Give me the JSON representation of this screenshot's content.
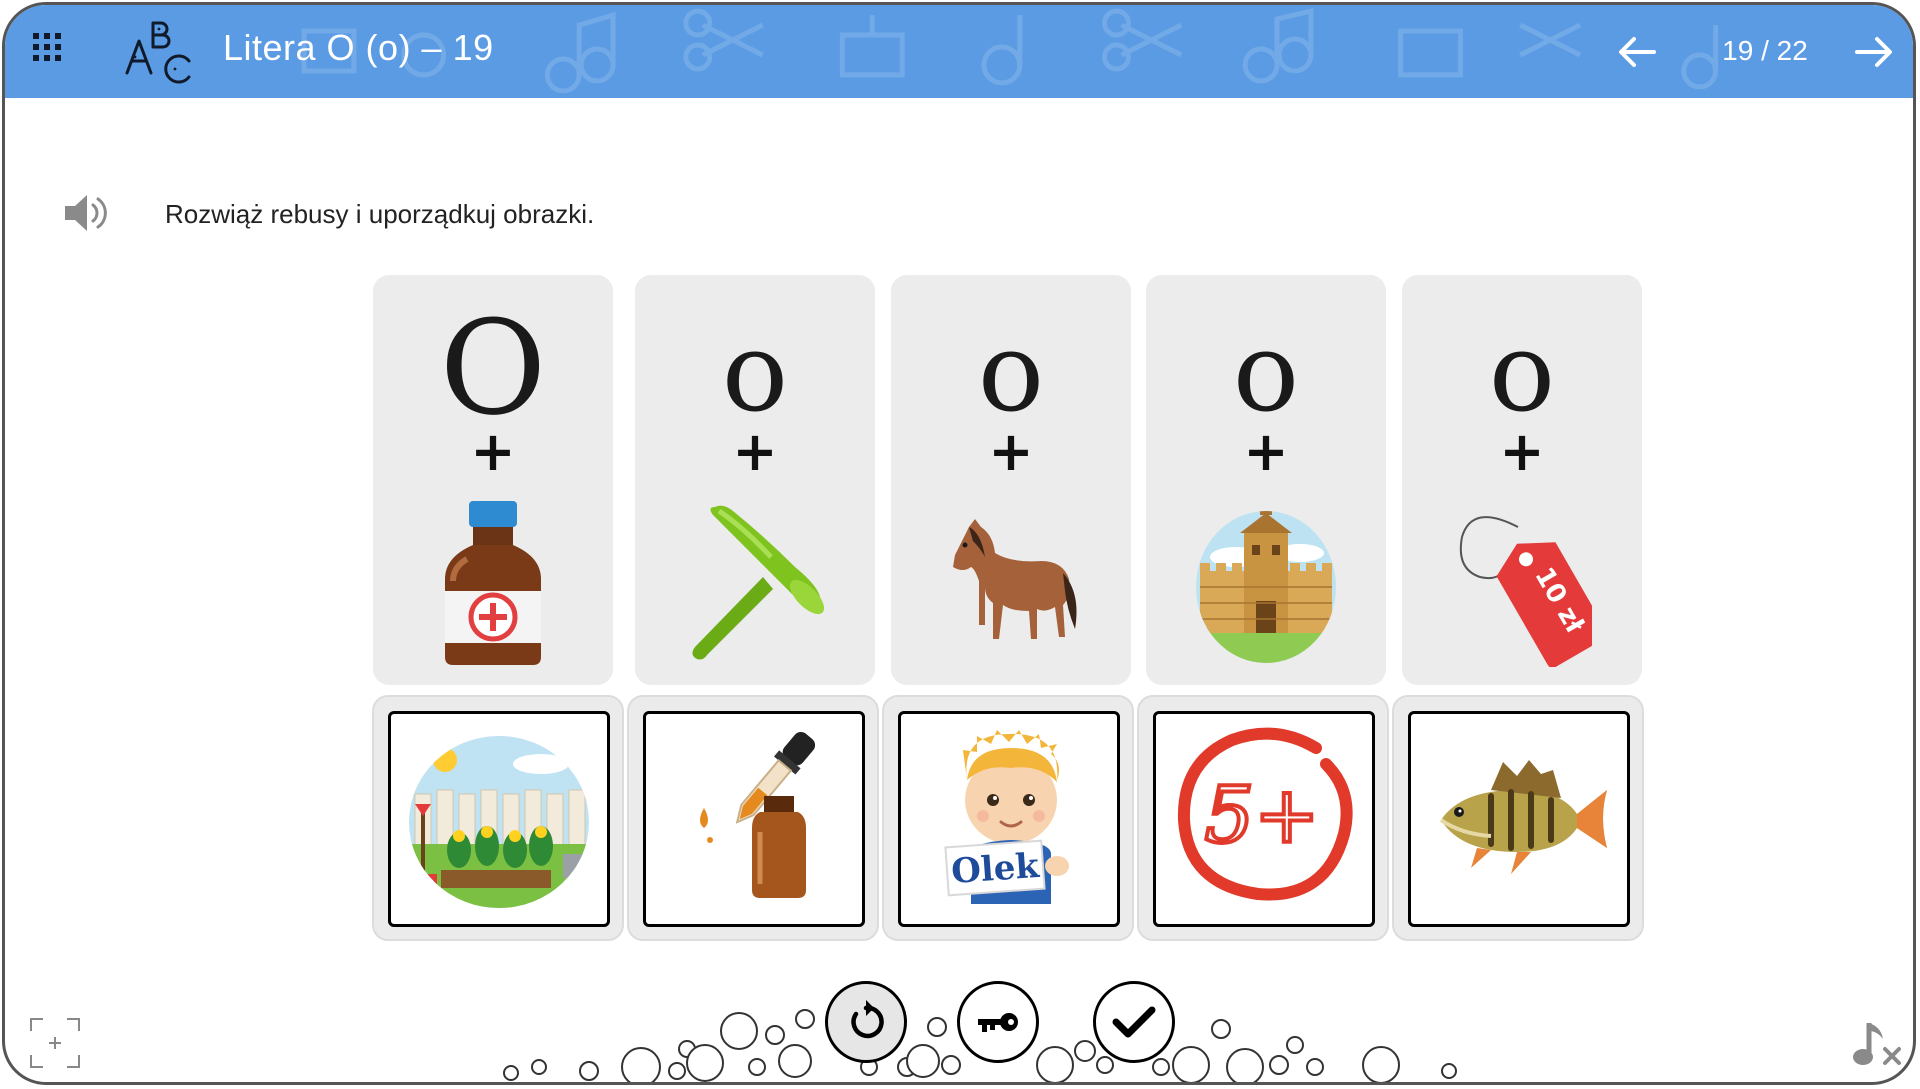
{
  "header": {
    "title": "Litera O (o) – 19",
    "page_counter": "19 / 22",
    "color": "#5b9be3",
    "menu_icon": "grid-menu-icon",
    "logo_icon": "abc-letters-icon",
    "prev_icon": "arrow-left-icon",
    "next_icon": "arrow-right-icon"
  },
  "task": {
    "instruction": "Rozwiąż rebusy i uporządkuj obrazki.",
    "speaker_icon": "speaker-icon"
  },
  "clues": [
    {
      "letter": "O",
      "plus": "+",
      "picture": "medicine-bottle-icon"
    },
    {
      "letter": "o",
      "plus": "+",
      "picture": "funnel-icon"
    },
    {
      "letter": "o",
      "plus": "+",
      "picture": "horse-icon"
    },
    {
      "letter": "o",
      "plus": "+",
      "picture": "wooden-fort-icon"
    },
    {
      "letter": "o",
      "plus": "+",
      "picture": "price-tag-icon",
      "tag_text": "10 zł"
    }
  ],
  "answers": [
    {
      "picture": "garden-icon"
    },
    {
      "picture": "dropper-bottle-icon"
    },
    {
      "picture": "boy-with-sign-icon",
      "sign_text": "Olek"
    },
    {
      "picture": "grade-five-plus-icon",
      "grade_text": "5+"
    },
    {
      "picture": "perch-fish-icon"
    }
  ],
  "controls": {
    "reset_icon": "reset-icon",
    "key_icon": "key-icon",
    "check_icon": "check-icon",
    "fullscreen_icon": "fullscreen-icon",
    "music_icon": "music-off-icon"
  }
}
